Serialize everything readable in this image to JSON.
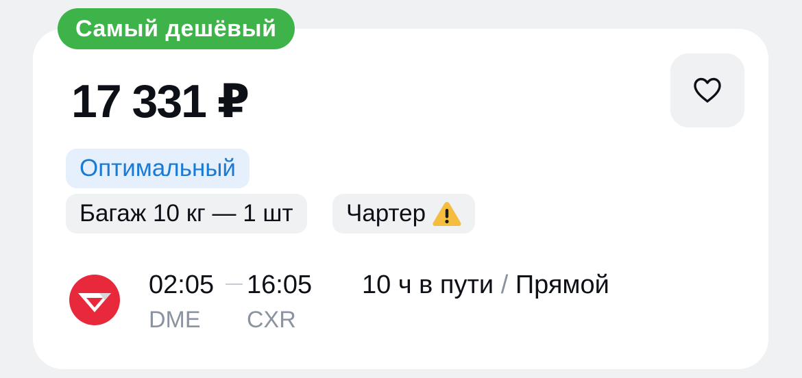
{
  "badge": {
    "label": "Самый дешёвый",
    "color": "#3db34a"
  },
  "price": {
    "value": "17 331 ₽"
  },
  "favorite": {
    "icon": "heart-icon"
  },
  "tags": {
    "tariff": "Оптимальный",
    "baggage": "Багаж 10 кг — 1 шт",
    "charter": "Чартер",
    "charter_icon": "warning-icon"
  },
  "flight": {
    "airline_logo": "airline-logo",
    "departure_time": "02:05",
    "arrival_time": "16:05",
    "departure_code": "DME",
    "arrival_code": "CXR",
    "duration": "10 ч в пути",
    "separator": "/",
    "type": "Прямой"
  },
  "colors": {
    "accent_blue": "#1a7ad4",
    "brand_red": "#e8293c",
    "warning_yellow": "#f5bd3f"
  }
}
